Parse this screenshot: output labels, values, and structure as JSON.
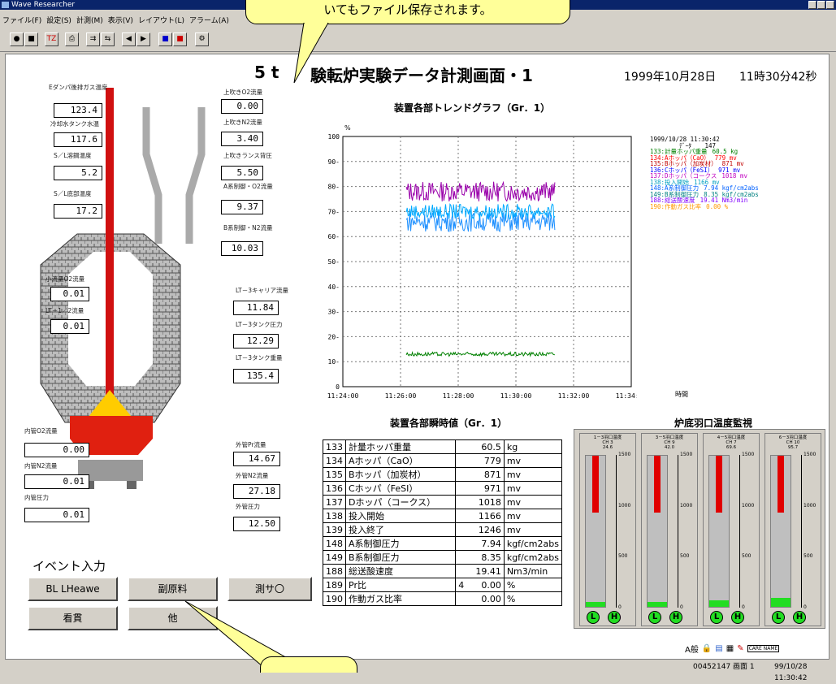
{
  "window": {
    "title": "Wave Researcher"
  },
  "menu": [
    "ファイル(F)",
    "設定(S)",
    "計測(M)",
    "表示(V)",
    "レイアウト(L)",
    "アラーム(A)"
  ],
  "toolbar": [
    "●",
    "■",
    "TZ",
    "⎙",
    "⇉",
    "⇆",
    "◀",
    "▶",
    "■",
    "■",
    "⚙"
  ],
  "callout": {
    "top_text": "いてもファイル保存されます。"
  },
  "page": {
    "title_a": "5 t",
    "title_b": "験転炉実験データ計測画面・1",
    "date": "1999年10月28日",
    "time": "11時30分42秒"
  },
  "left_labels": {
    "e_damper": "Eダンパ後排ガス温度",
    "cooling_tank": "冷却水タンク水温",
    "sl_cast": "S／L溶鋼温度",
    "sl_bottom": "S／L底部温度",
    "top_o2": "上吹きO2流量",
    "top_n2": "上吹きN2流量",
    "lance_back": "上吹きランス背圧",
    "a_o2": "A系制御・O2流量",
    "b_n2": "B系制御・N2流量",
    "small_o2": "小流量O2流量",
    "lt1_n2": "LT－1／2流量",
    "lt3_carrier": "LT－3キャリア流量",
    "lt3_tank_p": "LT－3タンク圧力",
    "lt3_tank_w": "LT－3タンク重量",
    "in_o2": "内管O2流量",
    "in_n2": "内管N2流量",
    "in_p": "内管圧力",
    "out_pr": "外管Pr流量",
    "out_n2": "外管N2流量",
    "out_p": "外管圧力"
  },
  "left_values": {
    "e_damper": "123.4",
    "cooling_tank": "117.6",
    "sl_cast": "5.2",
    "sl_bottom": "17.2",
    "top_o2": "0.00",
    "top_n2": "3.40",
    "lance_back": "5.50",
    "a_o2": "9.37",
    "b_n2": "10.03",
    "small_o2": "0.01",
    "lt1_n2": "0.01",
    "lt3_carrier": "11.84",
    "lt3_tank_p": "12.29",
    "lt3_tank_w": "135.4",
    "in_o2": "0.00",
    "in_n2": "0.01",
    "in_p": "0.01",
    "out_pr": "14.67",
    "out_n2": "27.18",
    "out_p": "12.50"
  },
  "event": {
    "title": "イベント入力",
    "buttons": [
      "BL LHeawe",
      "副原料",
      "測サ〇",
      "看貫",
      "他"
    ]
  },
  "trend": {
    "title": "装置各部トレンドグラフ（Gr．1）",
    "y_unit": "%",
    "x_unit": "時間",
    "legend_head": [
      "1999/10/28 11:30:42",
      "ﾃﾞｰﾀ",
      "147"
    ],
    "legend": [
      {
        "text": "133:計量ホッパ重量",
        "val": "60.5 kg",
        "color": "#008000"
      },
      {
        "text": "134:Aホッパ（CaO）",
        "val": "779 mv",
        "color": "#ff0000"
      },
      {
        "text": "135:Bホッパ（加炭材）",
        "val": "871 mv",
        "color": "#c00000"
      },
      {
        "text": "136:Cホッパ（FeSI）",
        "val": "971 mv",
        "color": "#0000ff"
      },
      {
        "text": "137:Dホッパ（コークス",
        "val": "1018 mv",
        "color": "#c000c0"
      },
      {
        "text": "138:投入開始",
        "val": "1166 mv",
        "color": "#00a0c0"
      },
      {
        "text": "148:A系制御圧力",
        "val": "7.94 kgf/cm2abs",
        "color": "#0060ff"
      },
      {
        "text": "149:B系制御圧力",
        "val": "8.35 kgf/cm2abs",
        "color": "#008080"
      },
      {
        "text": "188:総送酸速度",
        "val": "19.41 Nm3/min",
        "color": "#8000ff"
      },
      {
        "text": "190:作動ガス比率",
        "val": "0.00 %",
        "color": "#ff9900"
      }
    ]
  },
  "chart_data": {
    "type": "line",
    "ylim": [
      0,
      100
    ],
    "yticks": [
      "0",
      "10-",
      "20-",
      "30-",
      "40-",
      "50-",
      "60-",
      "70-",
      "80-",
      "90-",
      "100"
    ],
    "xticks": [
      "11:24:00",
      "11:26:00",
      "11:28:00",
      "11:30:00",
      "11:32:00",
      "11:34:00"
    ],
    "series": [
      {
        "color": "#9900aa",
        "level": 78,
        "amp": 4
      },
      {
        "color": "#1e90ff",
        "level": 66,
        "amp": 4
      },
      {
        "color": "#00aaff",
        "level": 70,
        "amp": 3
      },
      {
        "color": "#008000",
        "level": 13,
        "amp": 0.8
      }
    ]
  },
  "instant": {
    "title": "装置各部瞬時値（Gr．1）",
    "rows": [
      [
        "133",
        "計量ホッパ重量",
        "",
        "60.5",
        "kg"
      ],
      [
        "134",
        "Aホッパ（CaO）",
        "",
        "779",
        "mv"
      ],
      [
        "135",
        "Bホッパ（加炭材）",
        "",
        "871",
        "mv"
      ],
      [
        "136",
        "Cホッパ（FeSI）",
        "",
        "971",
        "mv"
      ],
      [
        "137",
        "Dホッパ（コークス）",
        "",
        "1018",
        "mv"
      ],
      [
        "138",
        "投入開始",
        "",
        "1166",
        "mv"
      ],
      [
        "139",
        "投入終了",
        "",
        "1246",
        "mv"
      ],
      [
        "148",
        "A系制御圧力",
        "",
        "7.94",
        "kgf/cm2abs"
      ],
      [
        "149",
        "B系制御圧力",
        "",
        "8.35",
        "kgf/cm2abs"
      ],
      [
        "188",
        "総送酸速度",
        "",
        "19.41",
        "Nm3/min"
      ],
      [
        "189",
        "Pr比",
        "4",
        "0.00",
        "%"
      ],
      [
        "190",
        "作動ガス比率",
        "",
        "0.00",
        "%"
      ]
    ]
  },
  "tuyere": {
    "title": "炉底羽口温度監視",
    "units": [
      {
        "label": "1－3羽口温度",
        "ch": "CH 3",
        "val": "24.6",
        "fill": 0.03
      },
      {
        "label": "3－5羽口温度",
        "ch": "CH 9",
        "val": "42.0",
        "fill": 0.03
      },
      {
        "label": "4－5羽口温度",
        "ch": "CH 7",
        "val": "69.6",
        "fill": 0.04
      },
      {
        "label": "6－3羽口温度",
        "ch": "CH 10",
        "val": "95.7",
        "fill": 0.06
      }
    ],
    "ticks": [
      "1500",
      "1000",
      "500",
      "0"
    ],
    "lamps": [
      "L",
      "H"
    ]
  },
  "bottom_tools": [
    "A般",
    "CARE NAME"
  ],
  "status": {
    "s1": "00452",
    "s2": "147 画面 1",
    "s3": "99/10/28 11:30:42"
  }
}
